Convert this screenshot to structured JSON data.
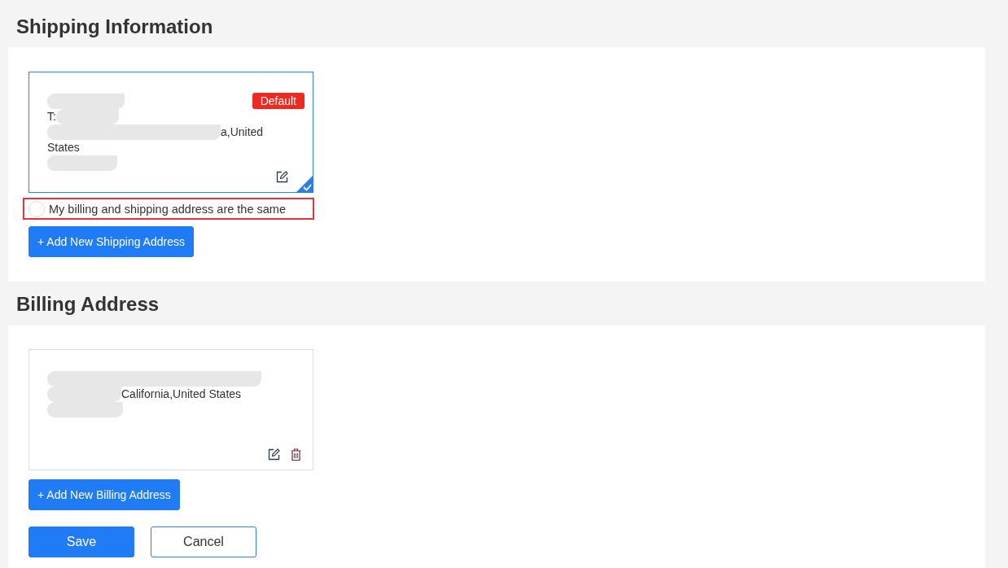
{
  "shipping": {
    "title": "Shipping Information",
    "cards": [
      {
        "selected": true,
        "badge": "Default",
        "lines": [
          [
            {
              "kind": "redacted"
            }
          ],
          [
            {
              "kind": "text",
              "text": "T:"
            },
            {
              "kind": "redacted"
            }
          ],
          [
            {
              "kind": "redacted"
            },
            {
              "kind": "text",
              "text": "a,United"
            }
          ],
          [
            {
              "kind": "text",
              "text": "States"
            }
          ],
          [
            {
              "kind": "redacted"
            }
          ]
        ],
        "actions": [
          {
            "kind": "edit"
          }
        ]
      }
    ],
    "same_address": {
      "label": "My billing and shipping address are the same",
      "checked": false,
      "highlighted": true
    },
    "add_button": "+ Add New Shipping Address"
  },
  "billing": {
    "title": "Billing Address",
    "cards": [
      {
        "selected": false,
        "lines": [
          [
            {
              "kind": "redacted"
            }
          ],
          [
            {
              "kind": "redacted"
            },
            {
              "kind": "text",
              "text": "California,United States"
            }
          ],
          [
            {
              "kind": "redacted"
            }
          ]
        ],
        "actions": [
          {
            "kind": "edit"
          },
          {
            "kind": "delete"
          }
        ]
      }
    ],
    "add_button": "+ Add New Billing Address"
  },
  "buttons": [
    {
      "label": "Save",
      "kind": "primary"
    },
    {
      "label": "Cancel",
      "kind": "secondary"
    }
  ]
}
